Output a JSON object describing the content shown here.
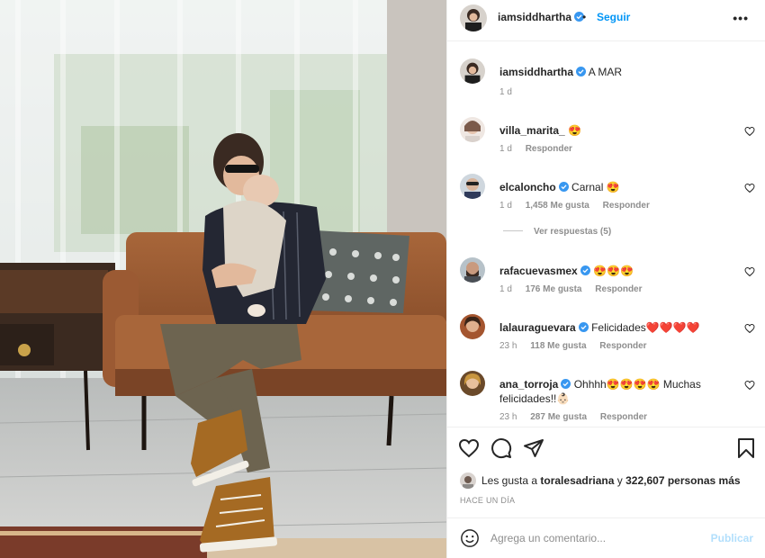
{
  "post": {
    "author": "iamsiddhartha",
    "follow_label": "Seguir",
    "more_label": "•••",
    "dot": "•"
  },
  "caption": {
    "user": "iamsiddhartha",
    "text": "A MAR",
    "time": "1 d"
  },
  "comments": [
    {
      "user": "villa_marita_",
      "text": "😍",
      "time": "1 d",
      "likes": "",
      "reply": "Responder",
      "verified": false
    },
    {
      "user": "elcaloncho",
      "text": "Carnal 😍",
      "time": "1 d",
      "likes": "1,458 Me gusta",
      "reply": "Responder",
      "verified": true
    },
    {
      "user": "rafacuevasmex",
      "text": "😍😍😍",
      "time": "1 d",
      "likes": "176 Me gusta",
      "reply": "Responder",
      "verified": true
    },
    {
      "user": "lalauraguevara",
      "text": "Felicidades❤️❤️❤️❤️",
      "time": "23 h",
      "likes": "118 Me gusta",
      "reply": "Responder",
      "verified": true
    },
    {
      "user": "ana_torroja",
      "text": "Ohhhh😍😍😍😍 Muchas felicidades!!👶🏻",
      "time": "23 h",
      "likes": "287 Me gusta",
      "reply": "Responder",
      "verified": true
    }
  ],
  "view_replies": "Ver respuestas (5)",
  "likes": {
    "prefix": "Les gusta a",
    "user": "toralesadriana",
    "connector": "y",
    "count": "322,607 personas más"
  },
  "time_ago": "HACE UN DÍA",
  "add_comment": {
    "placeholder": "Agrega un comentario...",
    "publish": "Publicar"
  },
  "colors": {
    "accent": "#0095f6",
    "verified": "#3897f0",
    "muted": "#8e8e8e",
    "publish_disabled": "#b2dffc"
  },
  "icons": [
    "verified-badge-icon",
    "heart-icon",
    "comment-icon",
    "share-icon",
    "bookmark-icon",
    "emoji-icon",
    "more-icon"
  ]
}
